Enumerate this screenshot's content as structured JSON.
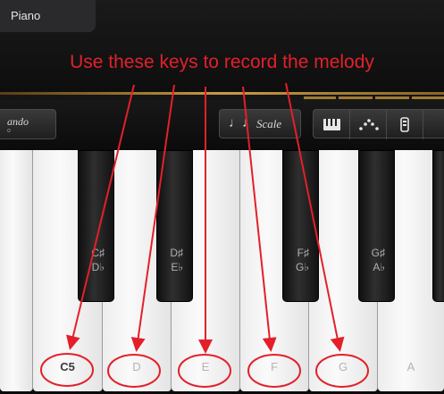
{
  "header": {
    "instrument_tab": "Piano"
  },
  "annotation": {
    "caption": "Use these keys to record the melody",
    "color": "#e3202a"
  },
  "controls": {
    "glissando_label": "ando",
    "glissando_sub": "o",
    "scale_notes_icon": "♩♩",
    "scale_label": "Scale",
    "segments": [
      {
        "name": "keys-icon"
      },
      {
        "name": "arpeggiator-icon"
      },
      {
        "name": "sustain-icon"
      }
    ]
  },
  "keyboard": {
    "white_keys": [
      {
        "label": ""
      },
      {
        "label": "C5"
      },
      {
        "label": "D"
      },
      {
        "label": "E"
      },
      {
        "label": "F"
      },
      {
        "label": "G"
      },
      {
        "label": "A"
      }
    ],
    "black_keys": [
      {
        "top": "C♯",
        "bottom": "D♭"
      },
      {
        "top": "D♯",
        "bottom": "E♭"
      },
      {
        "top": "F♯",
        "bottom": "G♭"
      },
      {
        "top": "G♯",
        "bottom": "A♭"
      },
      {
        "top": "",
        "bottom": ""
      }
    ],
    "highlighted_notes": [
      "C5",
      "D",
      "E",
      "F",
      "G"
    ]
  }
}
